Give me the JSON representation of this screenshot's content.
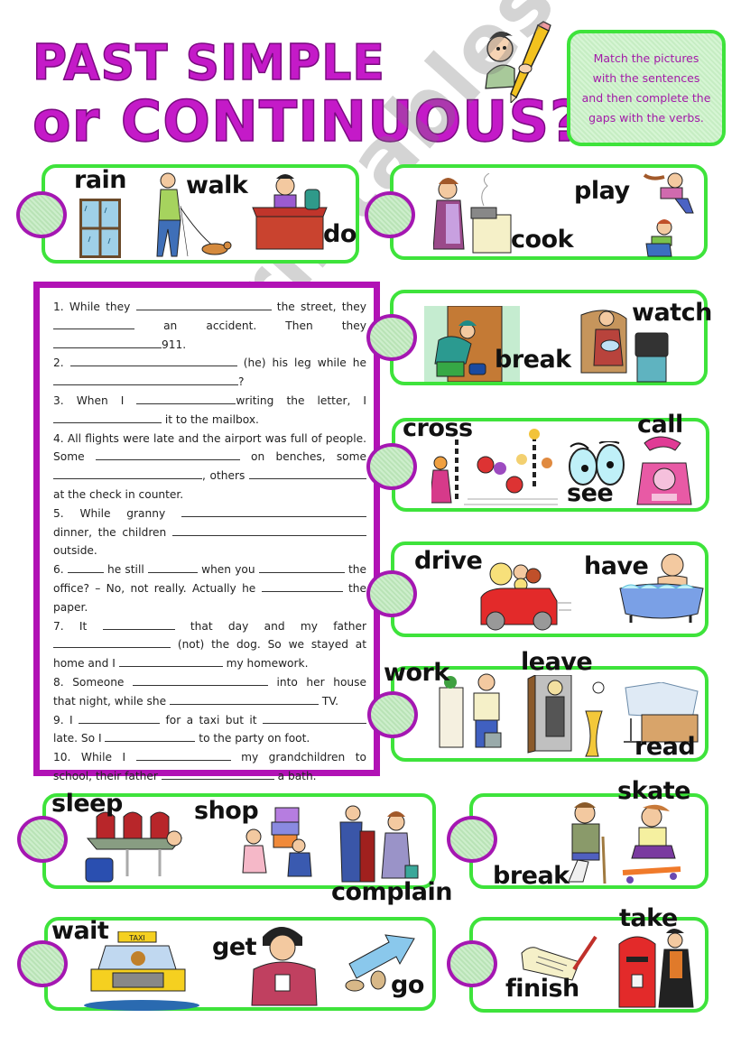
{
  "title": {
    "line1": "PAST SIMPLE",
    "line2": "or CONTINUOUS?"
  },
  "instructions": "Match the pictures with the sentences and then complete the gaps with the verbs.",
  "colors": {
    "title": "#c41ac8",
    "card_border": "#3ee33b",
    "exercise_border": "#b112b5",
    "answer_circle_border": "#a517b2",
    "answer_circle_fill": "#c6edc3"
  },
  "picture_cards": [
    {
      "verbs": [
        "rain",
        "walk",
        "do"
      ],
      "pictures": [
        "rainy-window",
        "man-walking-dog",
        "girl-doing-homework"
      ]
    },
    {
      "verbs": [
        "cook",
        "play"
      ],
      "pictures": [
        "woman-cooking",
        "children-playing"
      ]
    },
    {
      "verbs": [
        "break",
        "watch"
      ],
      "pictures": [
        "burglar-breaking-in",
        "granny-watching-tv"
      ]
    },
    {
      "verbs": [
        "cross",
        "see",
        "call"
      ],
      "pictures": [
        "people-crossing-street",
        "eyes",
        "pink-telephone-911"
      ]
    },
    {
      "verbs": [
        "drive",
        "have"
      ],
      "pictures": [
        "family-driving-car",
        "man-in-bath"
      ]
    },
    {
      "verbs": [
        "work",
        "leave",
        "read"
      ],
      "pictures": [
        "man-working-at-copier",
        "man-leaving-office",
        "man-reading-paper"
      ]
    },
    {
      "verbs": [
        "sleep",
        "shop",
        "complain"
      ],
      "pictures": [
        "man-sleeping-airport",
        "couple-shopping",
        "people-complaining-check-in"
      ]
    },
    {
      "verbs": [
        "break",
        "skate"
      ],
      "pictures": [
        "man-broken-leg",
        "girl-skating"
      ]
    },
    {
      "verbs": [
        "wait",
        "get",
        "go"
      ],
      "pictures": [
        "taxi",
        "man-looking-at-watch",
        "walking-arrow"
      ]
    },
    {
      "verbs": [
        "finish",
        "take"
      ],
      "pictures": [
        "letter-and-pen",
        "man-at-mailbox"
      ]
    }
  ],
  "exercise": {
    "items": [
      {
        "n": "1.",
        "parts": [
          "While they ",
          "_",
          " the street, they ",
          "_",
          " an accident. Then they ",
          "_",
          "911."
        ]
      },
      {
        "n": "2.",
        "parts": [
          "_",
          " (he) his leg while he ",
          "_",
          "?"
        ]
      },
      {
        "n": "3.",
        "parts": [
          "When I ",
          "_",
          "writing the letter, I ",
          "_",
          " it to the mailbox."
        ]
      },
      {
        "n": "4.",
        "parts": [
          "All flights were late and the airport was full of people. Some ",
          "_",
          " on benches, some ",
          "_",
          ", others ",
          "_",
          " at the check in counter."
        ]
      },
      {
        "n": "5.",
        "parts": [
          "While granny ",
          "_",
          " dinner, the children ",
          "_",
          " outside."
        ]
      },
      {
        "n": "6.",
        "parts": [
          "_",
          " he still ",
          "_",
          " when you ",
          "_",
          " the office? – No, not really. Actually he ",
          "_",
          " the paper."
        ]
      },
      {
        "n": "7.",
        "parts": [
          "It ",
          "_",
          " that day and my father ",
          "_",
          " (not) the dog. So we stayed at home and I ",
          "_",
          " my homework."
        ]
      },
      {
        "n": "8.",
        "parts": [
          "Someone ",
          "_",
          " into her house that night, while she ",
          "_",
          " TV."
        ]
      },
      {
        "n": "9.",
        "parts": [
          "I ",
          "_",
          " for a taxi but it ",
          "_",
          " late. So I ",
          "_",
          " to the party on foot."
        ]
      },
      {
        "n": "10.",
        "parts": [
          "While I ",
          "_",
          " my grandchildren to school, their father ",
          "_",
          " a bath."
        ]
      }
    ]
  },
  "watermark": "ESLprintables.com"
}
